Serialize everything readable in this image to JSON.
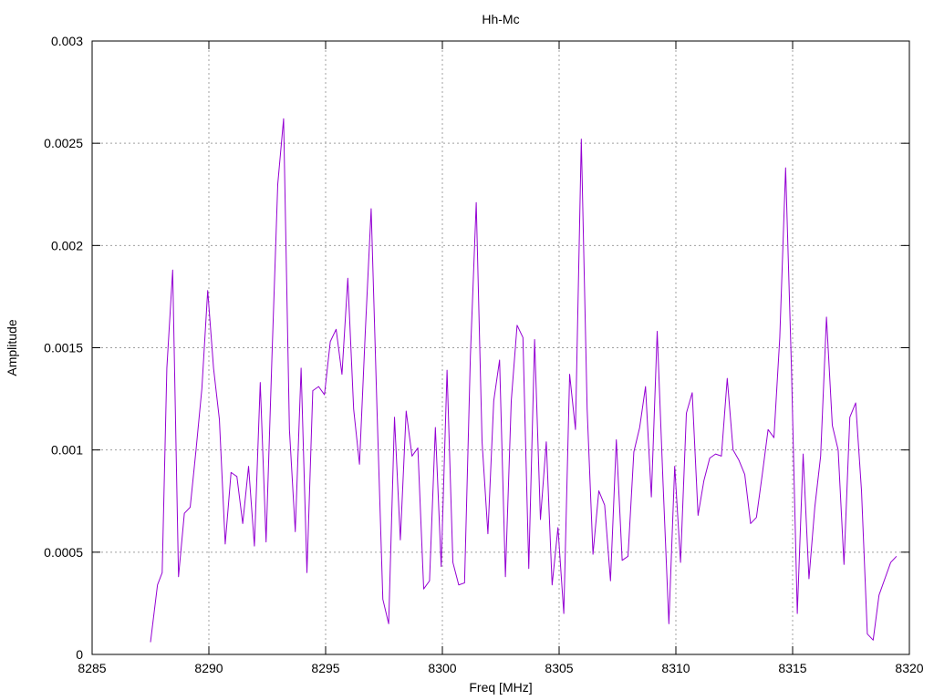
{
  "chart_data": {
    "type": "line",
    "title": "Hh-Mc",
    "xlabel": "Freq [MHz]",
    "ylabel": "Amplitude",
    "xlim": [
      8285,
      8320
    ],
    "ylim": [
      0,
      0.003
    ],
    "xticks": [
      8285,
      8290,
      8295,
      8300,
      8305,
      8310,
      8315,
      8320
    ],
    "yticks": [
      0,
      0.0005,
      0.001,
      0.0015,
      0.002,
      0.0025,
      0.003
    ],
    "xtick_labels": [
      "8285",
      "8290",
      "8295",
      "8300",
      "8305",
      "8310",
      "8315",
      "8320"
    ],
    "ytick_labels": [
      "0",
      "0.0005",
      "0.001",
      "0.0015",
      "0.002",
      "0.0025",
      "0.003"
    ],
    "grid": true,
    "series": [
      {
        "color": "#9400d3",
        "x": [
          8287.5,
          8287.8,
          8288.0,
          8288.2,
          8288.45,
          8288.7,
          8288.95,
          8289.2,
          8289.45,
          8289.7,
          8289.95,
          8290.2,
          8290.45,
          8290.7,
          8290.95,
          8291.2,
          8291.45,
          8291.7,
          8291.95,
          8292.2,
          8292.45,
          8292.7,
          8292.95,
          8293.2,
          8293.45,
          8293.7,
          8293.95,
          8294.2,
          8294.45,
          8294.7,
          8294.95,
          8295.2,
          8295.45,
          8295.7,
          8295.95,
          8296.2,
          8296.45,
          8296.7,
          8296.95,
          8297.2,
          8297.45,
          8297.7,
          8297.95,
          8298.2,
          8298.45,
          8298.7,
          8298.95,
          8299.2,
          8299.45,
          8299.7,
          8299.95,
          8300.2,
          8300.45,
          8300.7,
          8300.95,
          8301.2,
          8301.45,
          8301.7,
          8301.95,
          8302.2,
          8302.45,
          8302.7,
          8302.95,
          8303.2,
          8303.45,
          8303.7,
          8303.95,
          8304.2,
          8304.45,
          8304.7,
          8304.95,
          8305.2,
          8305.45,
          8305.7,
          8305.95,
          8306.2,
          8306.45,
          8306.7,
          8306.95,
          8307.2,
          8307.45,
          8307.7,
          8307.95,
          8308.2,
          8308.45,
          8308.7,
          8308.95,
          8309.2,
          8309.45,
          8309.7,
          8309.95,
          8310.2,
          8310.45,
          8310.7,
          8310.95,
          8311.2,
          8311.45,
          8311.7,
          8311.95,
          8312.2,
          8312.45,
          8312.7,
          8312.95,
          8313.2,
          8313.45,
          8313.7,
          8313.95,
          8314.2,
          8314.45,
          8314.7,
          8314.95,
          8315.2,
          8315.45,
          8315.7,
          8315.95,
          8316.2,
          8316.45,
          8316.7,
          8316.95,
          8317.2,
          8317.45,
          8317.7,
          8317.95,
          8318.2,
          8318.45,
          8318.7,
          8318.95,
          8319.2,
          8319.45
        ],
        "y": [
          6e-05,
          0.00034,
          0.0004,
          0.0014,
          0.00188,
          0.00038,
          0.00069,
          0.00072,
          0.001,
          0.0013,
          0.00178,
          0.0014,
          0.00115,
          0.00054,
          0.00089,
          0.00087,
          0.00064,
          0.00092,
          0.00053,
          0.00133,
          0.00055,
          0.00145,
          0.0023,
          0.00262,
          0.0011,
          0.0006,
          0.0014,
          0.0004,
          0.00129,
          0.00131,
          0.00127,
          0.00153,
          0.00159,
          0.00137,
          0.00184,
          0.0012,
          0.00093,
          0.00158,
          0.00218,
          0.0012,
          0.00027,
          0.00015,
          0.00116,
          0.00056,
          0.00119,
          0.00097,
          0.00101,
          0.00032,
          0.00036,
          0.00111,
          0.00043,
          0.00139,
          0.00045,
          0.00034,
          0.00035,
          0.00146,
          0.00221,
          0.00104,
          0.00059,
          0.00124,
          0.00144,
          0.00038,
          0.00124,
          0.00161,
          0.00155,
          0.00042,
          0.00154,
          0.00066,
          0.00104,
          0.00034,
          0.00062,
          0.0002,
          0.00137,
          0.0011,
          0.00252,
          0.0012,
          0.00049,
          0.0008,
          0.00073,
          0.00036,
          0.00105,
          0.00046,
          0.00048,
          0.00099,
          0.00111,
          0.00131,
          0.00077,
          0.00158,
          0.00084,
          0.00015,
          0.00092,
          0.00045,
          0.00118,
          0.00128,
          0.00068,
          0.00085,
          0.00096,
          0.00098,
          0.00097,
          0.00135,
          0.001,
          0.00095,
          0.00088,
          0.00064,
          0.00067,
          0.00088,
          0.0011,
          0.00106,
          0.00155,
          0.00238,
          0.0014,
          0.0002,
          0.00098,
          0.00037,
          0.00072,
          0.00097,
          0.00165,
          0.00112,
          0.001,
          0.00044,
          0.00116,
          0.00123,
          0.0008,
          0.0001,
          7e-05,
          0.00029,
          0.00037,
          0.00045,
          0.00048
        ]
      }
    ]
  }
}
